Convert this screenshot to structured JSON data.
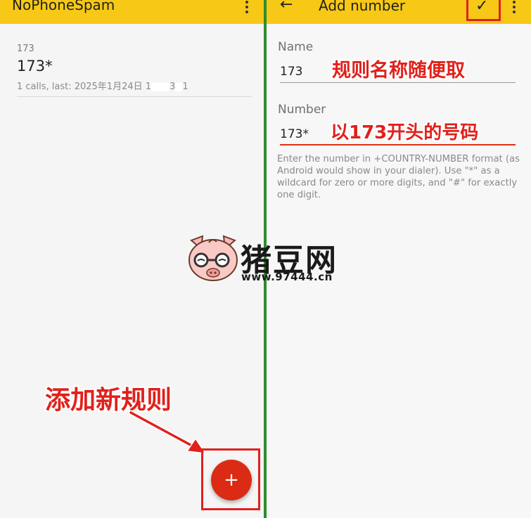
{
  "left": {
    "app_title": "NoPhoneSpam",
    "ghost_text": "...",
    "rule": {
      "label": "173",
      "number": "173*",
      "meta_prefix": "1 calls, last: 2025年1月24日 1",
      "meta_mid": "3",
      "meta_end": "1"
    },
    "fab_label": "+",
    "annotation": "添加新规则"
  },
  "right": {
    "title": "Add number",
    "ghost_text": "...",
    "back_icon": "←",
    "confirm_icon": "✓",
    "name": {
      "label": "Name",
      "value": "173"
    },
    "number": {
      "label": "Number",
      "value": "173*"
    },
    "help": "Enter the number in +COUNTRY-NUMBER format (as Android would show in your dialer). Use \"*\" as a wildcard for zero or more digits, and \"#\" for exactly one digit.",
    "annotation_name": "规则名称随便取",
    "annotation_number": "以173开头的号码"
  },
  "watermark": {
    "name": "猪豆网",
    "url": "www.97444.cn"
  },
  "colors": {
    "appbar": "#f7c815",
    "accent": "#dc2b15",
    "annotation": "#e0211b",
    "divider": "#2e8b2e"
  },
  "icons": [
    "back-arrow-icon",
    "check-icon",
    "overflow-menu-icon",
    "add-icon"
  ]
}
